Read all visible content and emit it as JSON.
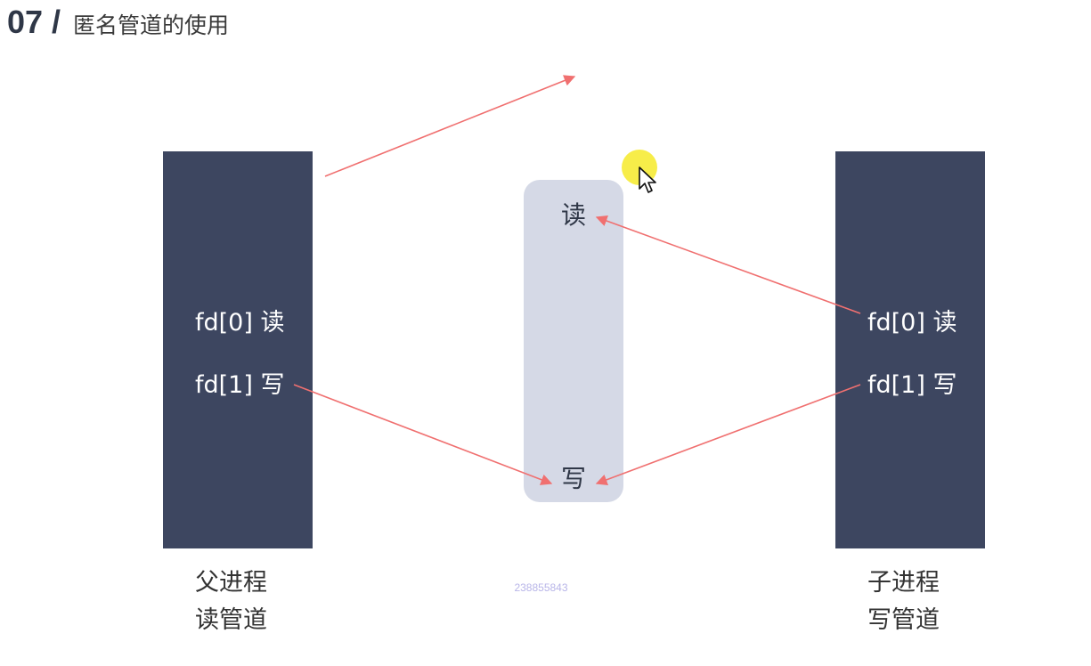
{
  "heading": {
    "number": "07 /",
    "title": "匿名管道的使用"
  },
  "pipe": {
    "read_label": "读",
    "write_label": "写"
  },
  "parent": {
    "fd0": "fd[0] 读",
    "fd1": "fd[1] 写",
    "caption_line1": "父进程",
    "caption_line2": "读管道"
  },
  "child": {
    "fd0": "fd[0] 读",
    "fd1": "fd[1] 写",
    "caption_line1": "子进程",
    "caption_line2": "写管道"
  },
  "watermark": "238855843",
  "colors": {
    "process_box": "#3d4660",
    "pipe": "#d5d9e6",
    "arrow": "#f07070",
    "cursor_halo": "#f6ec3a"
  }
}
